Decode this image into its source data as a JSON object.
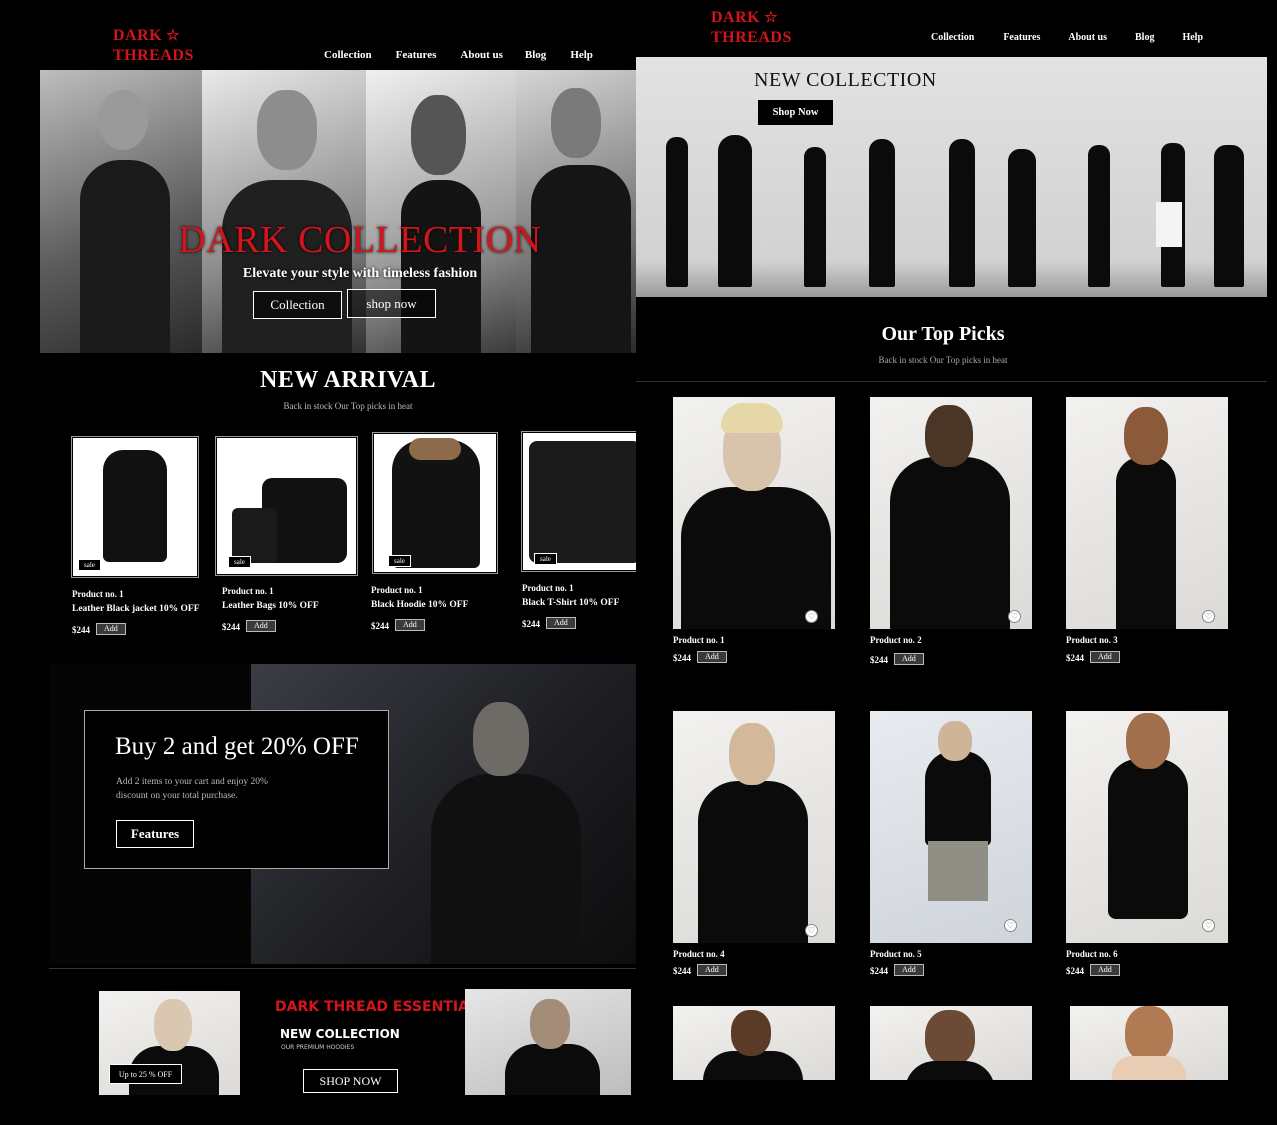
{
  "left": {
    "logo": {
      "line1": "DARK",
      "line2": "THREADS",
      "star": "☆"
    },
    "nav": [
      "Collection",
      "Features",
      "About us",
      "Blog",
      "Help"
    ],
    "hero": {
      "title": "DARK COLLECTION",
      "subtitle": "Elevate your style with timeless fashion",
      "btn_collection": "Collection",
      "btn_shop": "shop now"
    },
    "arrivals": {
      "heading": "NEW ARRIVAL",
      "subheading": "Back in stock Our Top picks in heat",
      "products": [
        {
          "name": "Product no. 1",
          "desc": "Leather Black jacket 10% OFF",
          "price": "$244",
          "badge": "sale",
          "add": "Add"
        },
        {
          "name": "Product no. 1",
          "desc": "Leather Bags 10% OFF",
          "price": "$244",
          "badge": "sale",
          "add": "Add"
        },
        {
          "name": "Product no. 1",
          "desc": "Black Hoodie 10% OFF",
          "price": "$244",
          "badge": "sale",
          "add": "Add"
        },
        {
          "name": "Product no. 1",
          "desc": "Black T-Shirt 10% OFF",
          "price": "$244",
          "badge": "sale",
          "add": "Add"
        }
      ]
    },
    "promo": {
      "title": "Buy 2 and get 20% OFF",
      "text1": "Add 2 items to your cart and enjoy 20%",
      "text2": "discount on your total purchase.",
      "button": "Features"
    },
    "essentials": {
      "title": "DARK THREAD ESSENTIALS",
      "subtitle": "NEW COLLECTION",
      "small": "OUR PREMIUM HOODIES",
      "badge": "Up to 25 % OFF",
      "button": "SHOP NOW"
    }
  },
  "right": {
    "logo": {
      "line1": "DARK",
      "line2": "THREADS",
      "star": "☆"
    },
    "nav": [
      "Collection",
      "Features",
      "About us",
      "Blog",
      "Help"
    ],
    "hero": {
      "title": "NEW COLLECTION",
      "button": "Shop Now"
    },
    "picks": {
      "heading": "Our Top Picks",
      "subheading": "Back in stock Our Top picks in heat",
      "products": [
        {
          "name": "Product no. 1",
          "price": "$244",
          "add": "Add"
        },
        {
          "name": "Product no. 2",
          "price": "$244",
          "add": "Add"
        },
        {
          "name": "Product no. 3",
          "price": "$244",
          "add": "Add"
        },
        {
          "name": "Product no. 4",
          "price": "$244",
          "add": "Add"
        },
        {
          "name": "Product no. 5",
          "price": "$244",
          "add": "Add"
        },
        {
          "name": "Product no.  6",
          "price": "$244",
          "add": "Add"
        }
      ]
    }
  },
  "colors": {
    "accent_red": "#d4141b",
    "background": "#000000",
    "button_grey": "#3a3a3a"
  }
}
